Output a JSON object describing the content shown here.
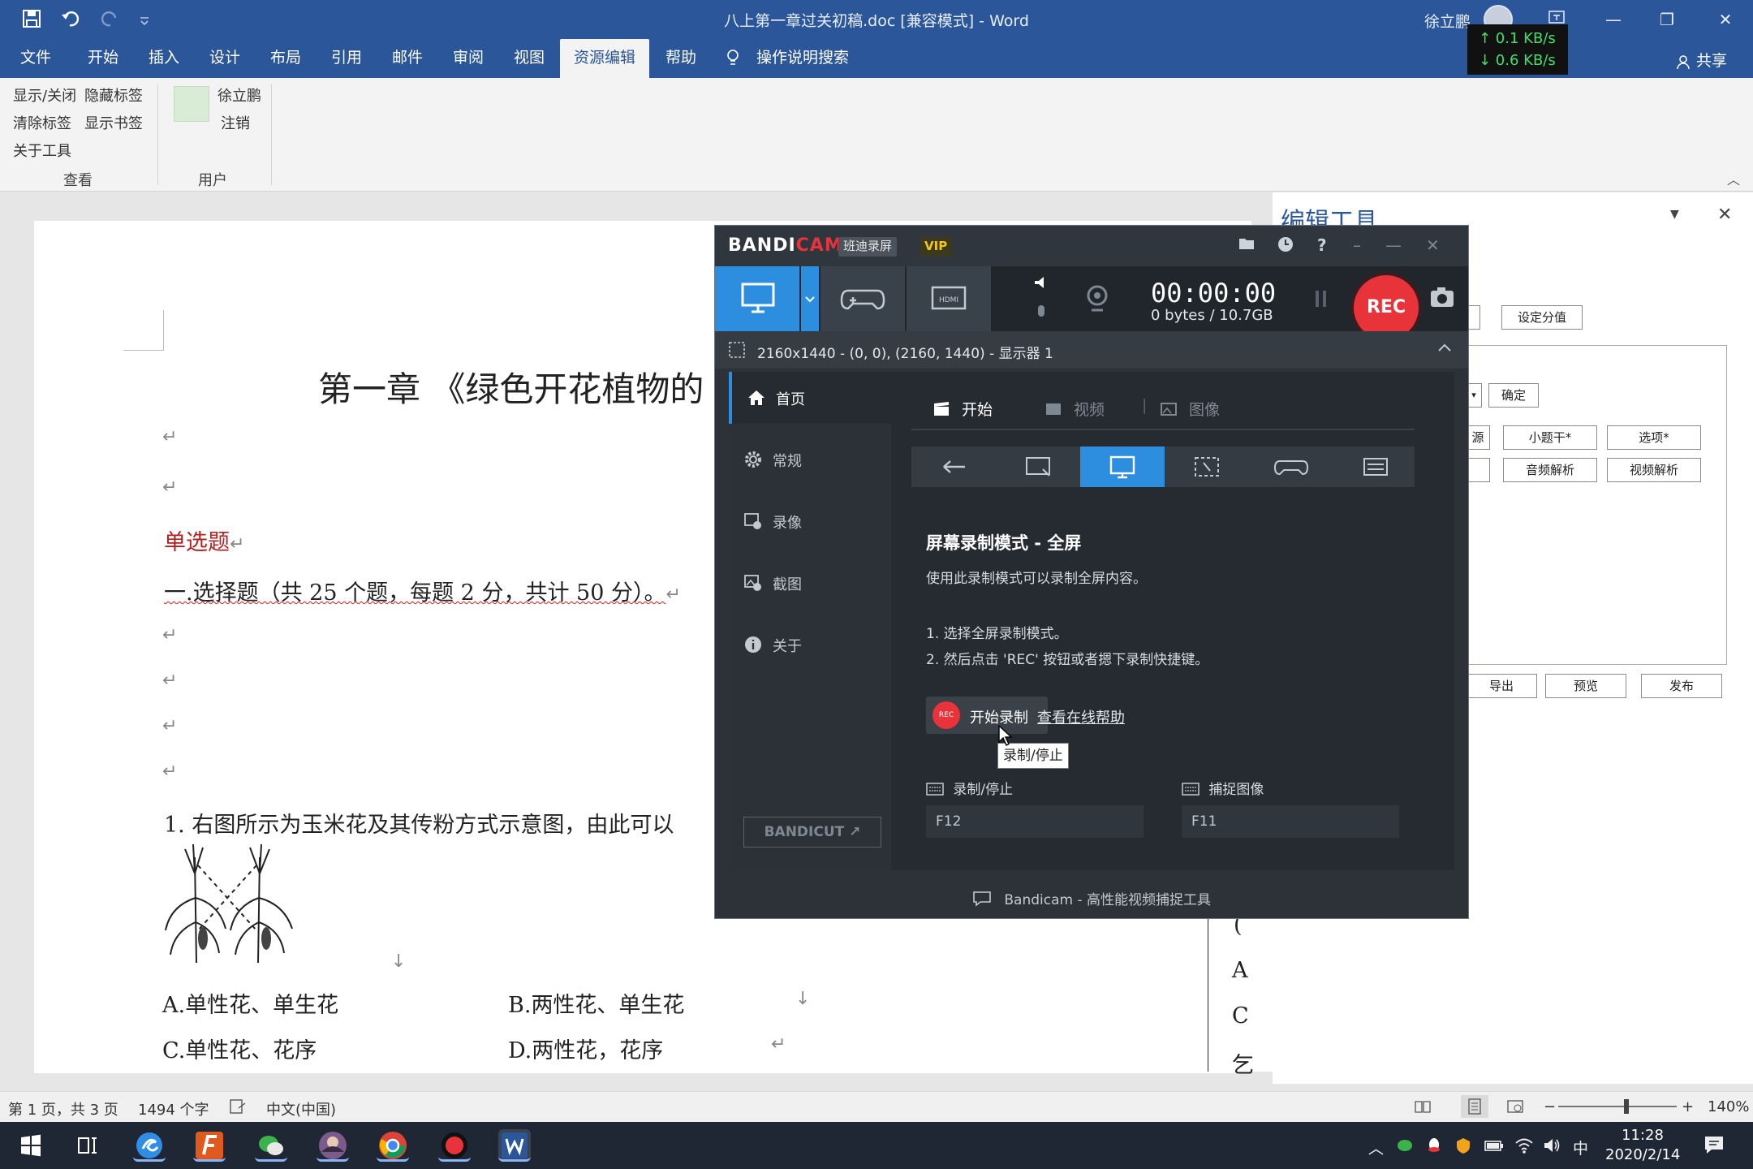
{
  "word": {
    "title": "八上第一章过关初稿.doc [兼容模式] - Word",
    "user": "徐立鹏",
    "netspeed": {
      "up": "↑ 0.1 KB/s",
      "down": "↓ 0.6 KB/s"
    },
    "tabs": [
      "文件",
      "开始",
      "插入",
      "设计",
      "布局",
      "引用",
      "邮件",
      "审阅",
      "视图",
      "资源编辑",
      "帮助"
    ],
    "active_tab": "资源编辑",
    "search_label": "操作说明搜索",
    "share_label": "共享",
    "ribbon": {
      "view_group": {
        "items": [
          "显示/关闭",
          "隐藏标签",
          "清除标签",
          "显示书签",
          "关于工具"
        ],
        "label": "查看"
      },
      "user_group": {
        "name": "徐立鹏",
        "logout": "注销",
        "label": "用户"
      }
    }
  },
  "document": {
    "title": "第一章 《绿色开花植物的",
    "section": "单选题",
    "instruction": "一.选择题（共 25 个题，每题 2 分，共计 50 分）。",
    "question1": "1. 右图所示为玉米花及其传粉方式示意图，由此可以",
    "options": [
      {
        "letter": "A.",
        "text": "单性花、单生花"
      },
      {
        "letter": "B.",
        "text": "两性花、单生花"
      },
      {
        "letter": "C.",
        "text": "单性花、花序"
      },
      {
        "letter": "D.",
        "text": "两性花，花序"
      }
    ],
    "para_mark": "↵",
    "arrow_mark": "↓",
    "page2_chars": [
      "(",
      "A",
      "C",
      "乞"
    ]
  },
  "task_pane": {
    "title": "编辑工具",
    "buttons": [
      "设定分值",
      "确定",
      "源",
      "小题干*",
      "选项*",
      "音频解析",
      "视频解析",
      "导出",
      "预览",
      "发布"
    ]
  },
  "statusbar": {
    "page": "第 1 页，共 3 页",
    "words": "1494 个字",
    "lang": "中文(中国)",
    "zoom": "140%",
    "zoom_level": 0.58
  },
  "taskbar": {
    "ime": "中",
    "time": "11:28",
    "date": "2020/2/14"
  },
  "bandicam": {
    "logo_main": "BANDI",
    "logo_cam": "CAM",
    "badge_cn": "班迪录屏",
    "badge_vip": "VIP",
    "timer": "00:00:00",
    "bytes": "0 bytes / 10.7GB",
    "rec_label": "REC",
    "area": "2160x1440 - (0, 0), (2160, 1440) - 显示器 1",
    "sidebar": [
      "首页",
      "常规",
      "录像",
      "截图",
      "关于"
    ],
    "bandicut": "BANDICUT ↗",
    "tabs": [
      "开始",
      "视频",
      "图像"
    ],
    "heading": "屏幕录制模式 - 全屏",
    "desc": "使用此录制模式可以录制全屏内容。",
    "step1": "1. 选择全屏录制模式。",
    "step2": "2. 然后点击 'REC' 按钮或者摁下录制快捷键。",
    "start_rec": "开始录制",
    "start_rec_dot": "REC",
    "help_link": "查看在线帮助",
    "tooltip": "录制/停止",
    "hotkey_rec_label": "录制/停止",
    "hotkey_rec": "F12",
    "hotkey_cap_label": "捕捉图像",
    "hotkey_cap": "F11",
    "footer": "Bandicam - 高性能视频捕捉工具"
  },
  "colors": {
    "word_blue": "#2b579a",
    "rec_red": "#e8333a",
    "bc_accent": "#2d8ee0"
  }
}
